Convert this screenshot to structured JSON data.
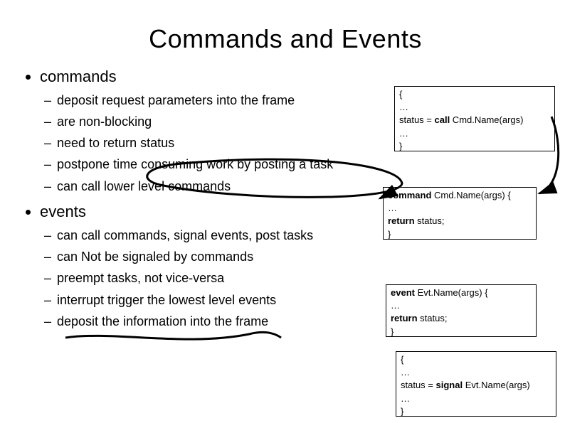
{
  "title": "Commands and Events",
  "bullets": {
    "level1": [
      {
        "label": "commands"
      },
      {
        "label": "events"
      }
    ],
    "commands_children": [
      "deposit request parameters into the frame",
      "are non-blocking",
      "need to return status",
      "postpone time consuming work by posting a task",
      "can call lower level commands"
    ],
    "events_children": [
      "can call commands, signal events, post tasks",
      "can Not be signaled by commands",
      "preempt tasks, not vice-versa",
      "interrupt trigger the lowest level events",
      "deposit the information into the frame"
    ]
  },
  "code": {
    "box1": {
      "l1": "{",
      "l2": "…",
      "l3_pre": " status = ",
      "l3_kw": "call",
      "l3_post": " Cmd.Name(args)",
      "l4": "…",
      "l5": "}"
    },
    "box2": {
      "l1_kw": "command",
      "l1_post": " Cmd.Name(args) {",
      "l2": "…",
      "l3_kw": "return",
      "l3_post": " status;",
      "l4": "}"
    },
    "box3": {
      "l1_kw": "event",
      "l1_post": " Evt.Name(args) {",
      "l2": "…",
      "l3_kw": "return",
      "l3_post": " status;",
      "l4": "}"
    },
    "box4": {
      "l1": "{",
      "l2": "…",
      "l3_pre": " status = ",
      "l3_kw": "signal",
      "l3_post": " Evt.Name(args)",
      "l4": "…",
      "l5": "}"
    }
  }
}
